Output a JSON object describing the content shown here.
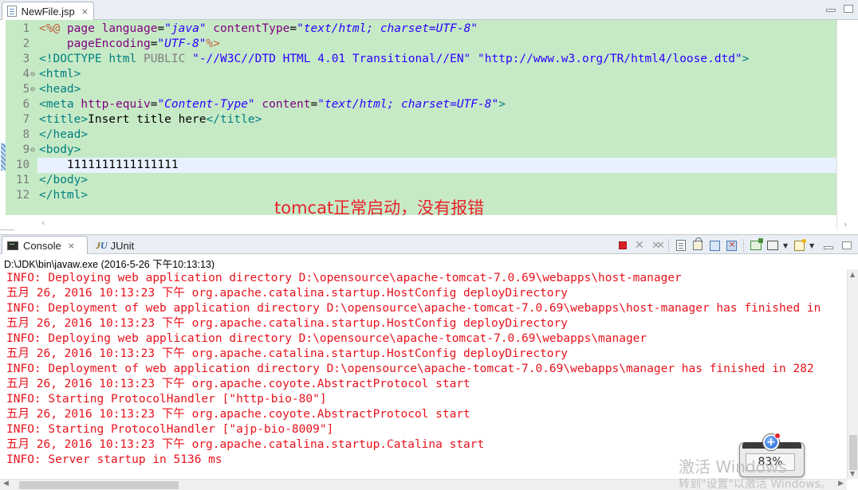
{
  "editor_tab": {
    "label": "NewFile.jsp",
    "close": "⨯"
  },
  "editor": {
    "line_numbers": [
      "1",
      "2",
      "3",
      "4",
      "5",
      "6",
      "7",
      "8",
      "9",
      "10",
      "11",
      "12"
    ],
    "fold_markers": [
      "",
      "",
      "",
      "⊖",
      "⊖",
      "",
      "",
      "",
      "⊖",
      "",
      "",
      ""
    ],
    "lines": [
      [
        [
          "t-dir",
          "<%@"
        ],
        [
          "t-text",
          " "
        ],
        [
          "t-attr",
          "page"
        ],
        [
          "t-text",
          " "
        ],
        [
          "t-attr",
          "language"
        ],
        [
          "t-text",
          "="
        ],
        [
          "t-val",
          "\"java\""
        ],
        [
          "t-text",
          " "
        ],
        [
          "t-attr",
          "contentType"
        ],
        [
          "t-text",
          "="
        ],
        [
          "t-val",
          "\"text/html; charset=UTF-8\""
        ]
      ],
      [
        [
          "t-text",
          "    "
        ],
        [
          "t-attr",
          "pageEncoding"
        ],
        [
          "t-text",
          "="
        ],
        [
          "t-val",
          "\"UTF-8\""
        ],
        [
          "t-dir",
          "%>"
        ]
      ],
      [
        [
          "t-doc",
          "<!DOCTYPE"
        ],
        [
          "t-text",
          " "
        ],
        [
          "t-doc",
          "html"
        ],
        [
          "t-text",
          " "
        ],
        [
          "t-kw",
          "PUBLIC"
        ],
        [
          "t-text",
          " "
        ],
        [
          "t-str",
          "\"-//W3C//DTD HTML 4.01 Transitional//EN\""
        ],
        [
          "t-text",
          " "
        ],
        [
          "t-str",
          "\"http://www.w3.org/TR/html4/loose.dtd\""
        ],
        [
          "t-doc",
          ">"
        ]
      ],
      [
        [
          "t-tag",
          "<html>"
        ]
      ],
      [
        [
          "t-tag",
          "<head>"
        ]
      ],
      [
        [
          "t-tag",
          "<meta"
        ],
        [
          "t-text",
          " "
        ],
        [
          "t-attr",
          "http-equiv"
        ],
        [
          "t-text",
          "="
        ],
        [
          "t-val",
          "\"Content-Type\""
        ],
        [
          "t-text",
          " "
        ],
        [
          "t-attr",
          "content"
        ],
        [
          "t-text",
          "="
        ],
        [
          "t-val",
          "\"text/html; charset=UTF-8\""
        ],
        [
          "t-tag",
          ">"
        ]
      ],
      [
        [
          "t-tag",
          "<title>"
        ],
        [
          "t-text",
          "Insert title here"
        ],
        [
          "t-tag",
          "</title>"
        ]
      ],
      [
        [
          "t-tag",
          "</head>"
        ]
      ],
      [
        [
          "t-tag",
          "<body>"
        ]
      ],
      [
        [
          "t-text",
          "    1111111111111111"
        ]
      ],
      [
        [
          "t-tag",
          "</body>"
        ]
      ],
      [
        [
          "t-tag",
          "</html>"
        ]
      ]
    ],
    "annotation": "tomcat正常启动，没有报错"
  },
  "console": {
    "tab_label": "Console",
    "tab_close": "⨯",
    "junit_label": "JUnit",
    "path": "D:\\JDK\\bin\\javaw.exe (2016-5-26 下午10:13:13)",
    "lines": [
      "INFO: Deploying web application directory D:\\opensource\\apache-tomcat-7.0.69\\webapps\\host-manager",
      "五月 26, 2016 10:13:23 下午 org.apache.catalina.startup.HostConfig deployDirectory",
      "INFO: Deployment of web application directory D:\\opensource\\apache-tomcat-7.0.69\\webapps\\host-manager has finished in",
      "五月 26, 2016 10:13:23 下午 org.apache.catalina.startup.HostConfig deployDirectory",
      "INFO: Deploying web application directory D:\\opensource\\apache-tomcat-7.0.69\\webapps\\manager",
      "五月 26, 2016 10:13:23 下午 org.apache.catalina.startup.HostConfig deployDirectory",
      "INFO: Deployment of web application directory D:\\opensource\\apache-tomcat-7.0.69\\webapps\\manager has finished in 282",
      "五月 26, 2016 10:13:23 下午 org.apache.coyote.AbstractProtocol start",
      "INFO: Starting ProtocolHandler [\"http-bio-80\"]",
      "五月 26, 2016 10:13:23 下午 org.apache.coyote.AbstractProtocol start",
      "INFO: Starting ProtocolHandler [\"ajp-bio-8009\"]",
      "五月 26, 2016 10:13:23 下午 org.apache.catalina.startup.Catalina start",
      "INFO: Server startup in 5136 ms"
    ]
  },
  "overlay": {
    "speed_value": "83%",
    "watermark_line1": "激活 Windows",
    "watermark_line2": "转到\"设置\"以激活 Windows。"
  },
  "colors": {
    "editor_bg": "#c7eac6",
    "current_line": "#e8f2fe",
    "console_text": "#e8121c",
    "annotation": "#e8222b"
  }
}
